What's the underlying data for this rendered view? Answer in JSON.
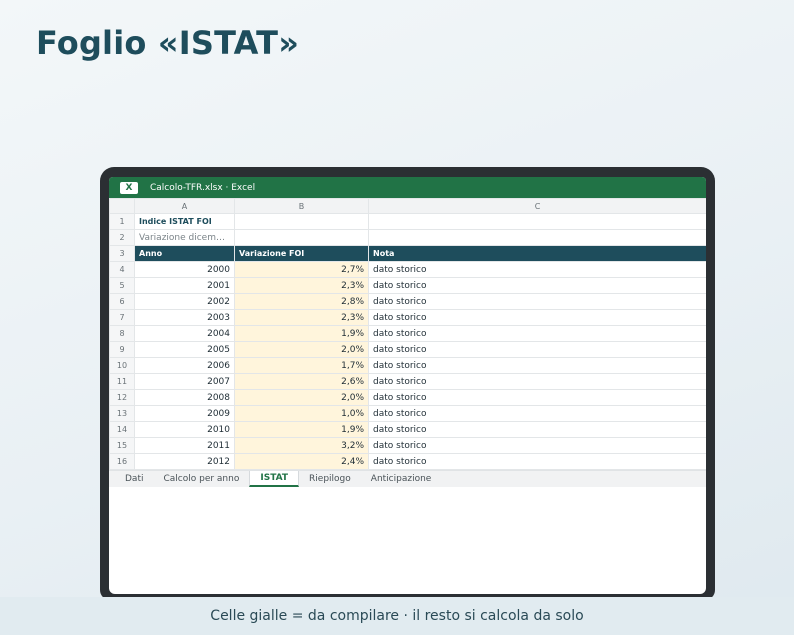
{
  "page": {
    "title": "Foglio «ISTAT»"
  },
  "window": {
    "app_badge": "X",
    "title": "Calcolo-TFR.xlsx · Excel"
  },
  "colors": {
    "excel_green": "#217346",
    "header_teal": "#1e4d5c",
    "input_yellow": "#fff5dc"
  },
  "sheet": {
    "columns": [
      "A",
      "B",
      "C"
    ],
    "row_numbers": [
      "1",
      "2",
      "3",
      "4",
      "5",
      "6",
      "7",
      "8",
      "9",
      "10",
      "11",
      "12",
      "13",
      "14",
      "15",
      "16"
    ],
    "title": "Indice ISTAT FOI",
    "subtitle": "Variazione dicembre su dicembre",
    "header": {
      "anno": "Anno",
      "variazione": "Variazione FOI",
      "nota": "Nota"
    },
    "rows": [
      {
        "anno": "2000",
        "variazione": "2,7%",
        "nota": "dato storico"
      },
      {
        "anno": "2001",
        "variazione": "2,3%",
        "nota": "dato storico"
      },
      {
        "anno": "2002",
        "variazione": "2,8%",
        "nota": "dato storico"
      },
      {
        "anno": "2003",
        "variazione": "2,3%",
        "nota": "dato storico"
      },
      {
        "anno": "2004",
        "variazione": "1,9%",
        "nota": "dato storico"
      },
      {
        "anno": "2005",
        "variazione": "2,0%",
        "nota": "dato storico"
      },
      {
        "anno": "2006",
        "variazione": "1,7%",
        "nota": "dato storico"
      },
      {
        "anno": "2007",
        "variazione": "2,6%",
        "nota": "dato storico"
      },
      {
        "anno": "2008",
        "variazione": "2,0%",
        "nota": "dato storico"
      },
      {
        "anno": "2009",
        "variazione": "1,0%",
        "nota": "dato storico"
      },
      {
        "anno": "2010",
        "variazione": "1,9%",
        "nota": "dato storico"
      },
      {
        "anno": "2011",
        "variazione": "3,2%",
        "nota": "dato storico"
      },
      {
        "anno": "2012",
        "variazione": "2,4%",
        "nota": "dato storico"
      }
    ]
  },
  "tabs": [
    "Dati",
    "Calcolo per anno",
    "ISTAT",
    "Riepilogo",
    "Anticipazione"
  ],
  "active_tab": "ISTAT",
  "footer": {
    "caption": "Celle gialle = da compilare · il resto si calcola da solo"
  }
}
